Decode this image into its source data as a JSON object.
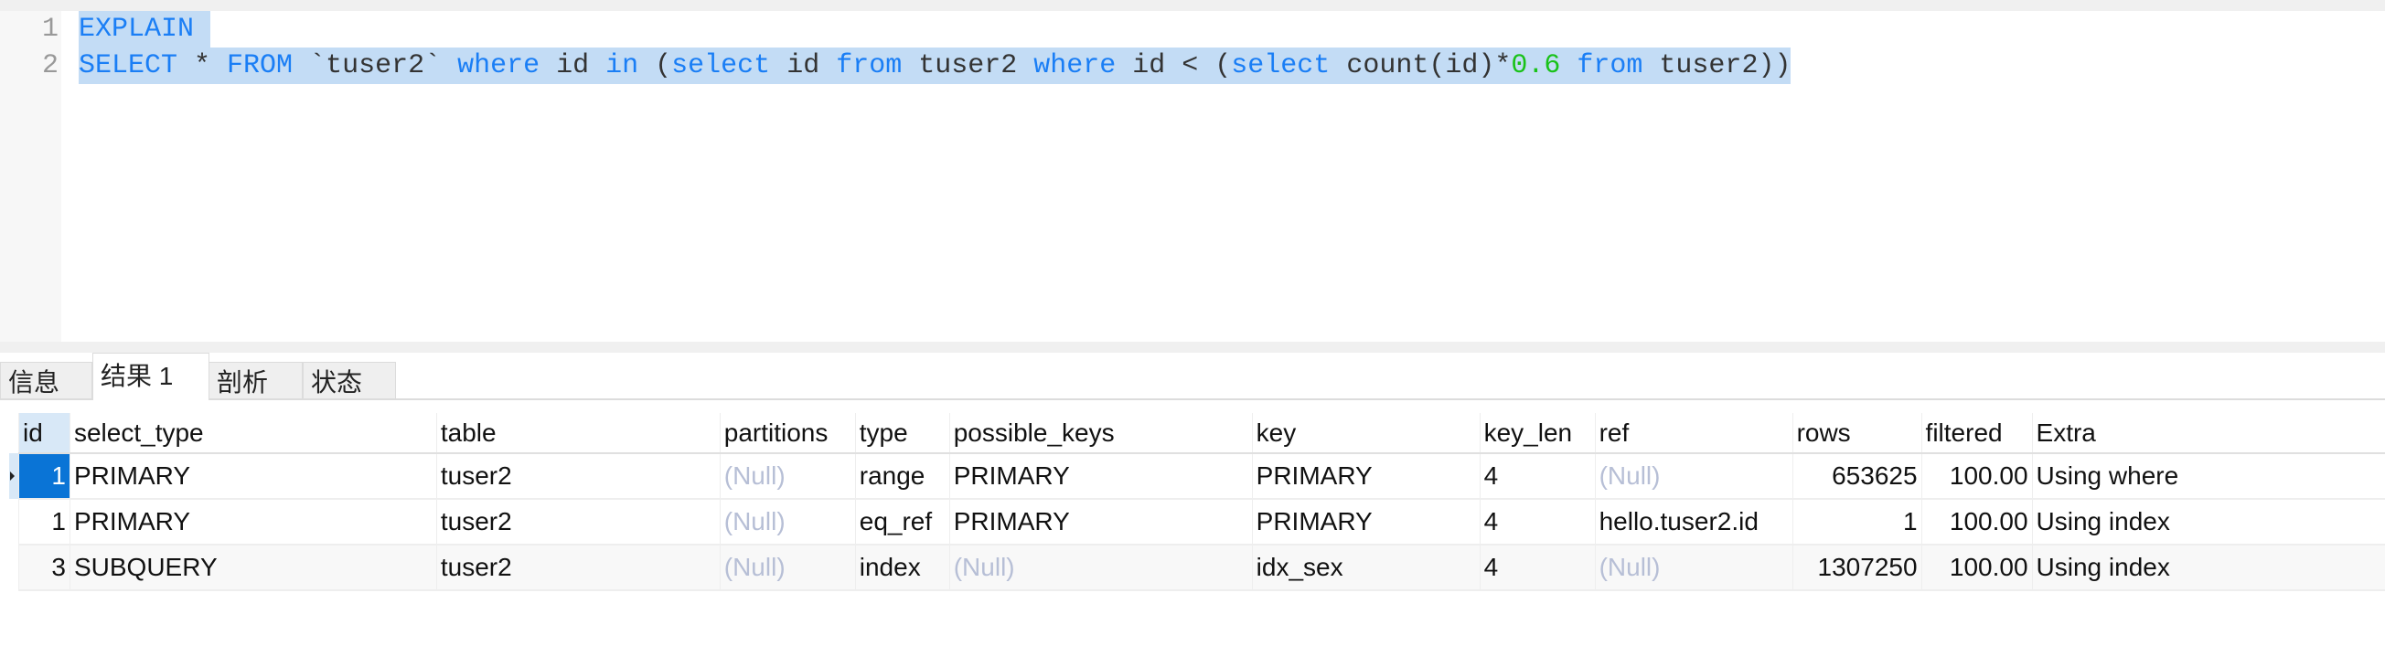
{
  "editor": {
    "lines": [
      {
        "number": "1",
        "tokens": [
          {
            "t": "EXPLAIN",
            "c": "kw"
          },
          {
            "t": " ",
            "c": "id"
          }
        ]
      },
      {
        "number": "2",
        "tokens": [
          {
            "t": "SELECT",
            "c": "kw"
          },
          {
            "t": " * ",
            "c": "id"
          },
          {
            "t": "FROM",
            "c": "kw"
          },
          {
            "t": " `tuser2` ",
            "c": "id"
          },
          {
            "t": "where",
            "c": "kw"
          },
          {
            "t": " id ",
            "c": "id"
          },
          {
            "t": "in",
            "c": "kw"
          },
          {
            "t": " (",
            "c": "id"
          },
          {
            "t": "select",
            "c": "kw"
          },
          {
            "t": " id ",
            "c": "id"
          },
          {
            "t": "from",
            "c": "kw"
          },
          {
            "t": " tuser2 ",
            "c": "id"
          },
          {
            "t": "where",
            "c": "kw"
          },
          {
            "t": " id < (",
            "c": "id"
          },
          {
            "t": "select",
            "c": "kw"
          },
          {
            "t": " count(id)*",
            "c": "id"
          },
          {
            "t": "0.6",
            "c": "num"
          },
          {
            "t": " ",
            "c": "id"
          },
          {
            "t": "from",
            "c": "kw"
          },
          {
            "t": " tuser2))",
            "c": "id"
          }
        ]
      }
    ]
  },
  "tabs": [
    {
      "label": "信息",
      "active": false
    },
    {
      "label": "结果 1",
      "active": true
    },
    {
      "label": "剖析",
      "active": false
    },
    {
      "label": "状态",
      "active": false
    }
  ],
  "results": {
    "columns": [
      "id",
      "select_type",
      "table",
      "partitions",
      "type",
      "possible_keys",
      "key",
      "key_len",
      "ref",
      "rows",
      "filtered",
      "Extra"
    ],
    "rows": [
      [
        "1",
        "PRIMARY",
        "tuser2",
        "(Null)",
        "range",
        "PRIMARY",
        "PRIMARY",
        "4",
        "(Null)",
        "653625",
        "100.00",
        "Using where"
      ],
      [
        "1",
        "PRIMARY",
        "tuser2",
        "(Null)",
        "eq_ref",
        "PRIMARY",
        "PRIMARY",
        "4",
        "hello.tuser2.id",
        "1",
        "100.00",
        "Using index"
      ],
      [
        "3",
        "SUBQUERY",
        "tuser2",
        "(Null)",
        "index",
        "(Null)",
        "idx_sex",
        "4",
        "(Null)",
        "1307250",
        "100.00",
        "Using index"
      ]
    ],
    "selected_row": 0
  },
  "colors": {
    "keyword": "#1a7ef5",
    "number": "#19c219",
    "selection": "#c3dcf5",
    "null": "#b7bfd6",
    "current_cell": "#0a74d6"
  }
}
